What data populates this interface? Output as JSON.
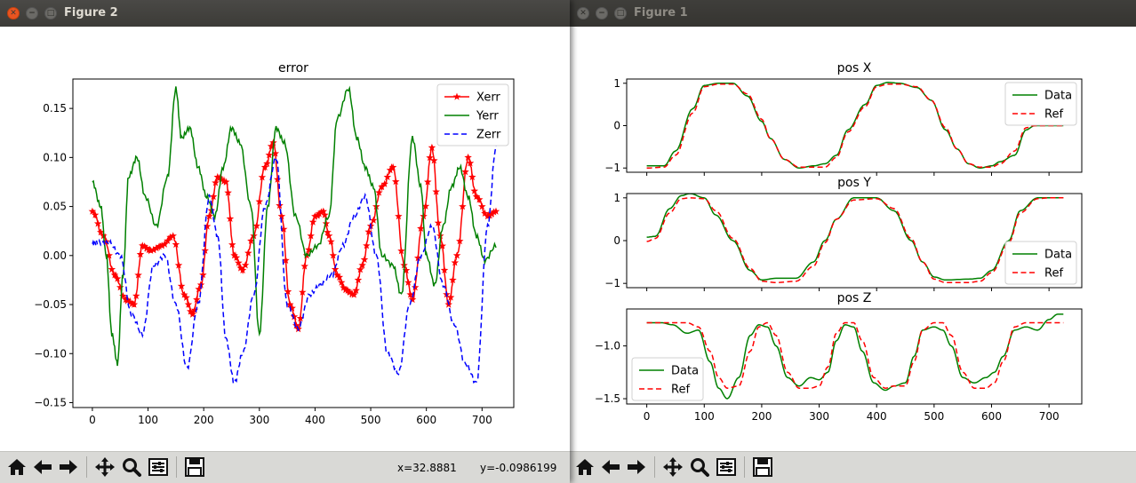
{
  "windows": {
    "figure2": {
      "title": "Figure 2"
    },
    "figure1": {
      "title": "Figure 1"
    }
  },
  "toolbar": {
    "icons": [
      "home-icon",
      "back-arrow-icon",
      "forward-arrow-icon",
      "pan-icon",
      "zoom-icon",
      "configure-subplots-icon",
      "save-icon"
    ],
    "coord_x": "x=32.8881",
    "coord_y": "y=-0.0986199"
  },
  "chart_data": [
    {
      "type": "line",
      "window": "Figure 2",
      "title": "error",
      "xlim": [
        -35,
        757
      ],
      "ylim": [
        -0.155,
        0.18
      ],
      "xticks": [
        0,
        100,
        200,
        300,
        400,
        500,
        600,
        700
      ],
      "yticks": [
        -0.15,
        -0.1,
        -0.05,
        0.0,
        0.05,
        0.1,
        0.15
      ],
      "ytick_labels": [
        "−0.15",
        "−0.10",
        "−0.05",
        "0.00",
        "0.05",
        "0.10",
        "0.15"
      ],
      "legend": "top-right",
      "series": [
        {
          "name": "Xerr",
          "color": "#ff0000",
          "style": "solid-star",
          "x": [
            0,
            20,
            40,
            60,
            75,
            90,
            105,
            125,
            145,
            165,
            180,
            195,
            210,
            225,
            240,
            255,
            270,
            290,
            310,
            325,
            340,
            355,
            370,
            385,
            400,
            415,
            425,
            440,
            455,
            470,
            485,
            500,
            520,
            540,
            560,
            575,
            595,
            610,
            625,
            640,
            655,
            675,
            690,
            710,
            725
          ],
          "y": [
            0.045,
            0.02,
            -0.02,
            -0.045,
            -0.05,
            0.01,
            0.005,
            0.01,
            0.02,
            -0.04,
            -0.06,
            -0.03,
            0.04,
            0.08,
            0.075,
            0.0,
            -0.015,
            0.02,
            0.09,
            0.115,
            0.04,
            -0.05,
            -0.075,
            0.0,
            0.04,
            0.045,
            0.02,
            -0.02,
            -0.035,
            -0.04,
            -0.01,
            0.03,
            0.07,
            0.09,
            -0.01,
            -0.045,
            0.04,
            0.11,
            0.02,
            -0.05,
            0.0,
            0.1,
            0.06,
            0.04,
            0.045
          ]
        },
        {
          "name": "Yerr",
          "color": "#008000",
          "style": "solid",
          "x": [
            0,
            15,
            25,
            35,
            45,
            55,
            65,
            80,
            95,
            115,
            135,
            150,
            160,
            175,
            190,
            205,
            220,
            235,
            250,
            265,
            285,
            300,
            315,
            330,
            345,
            365,
            385,
            405,
            425,
            440,
            460,
            475,
            490,
            505,
            520,
            540,
            555,
            575,
            590,
            600,
            615,
            630,
            645,
            660,
            675,
            690,
            705,
            725
          ],
          "y": [
            0.075,
            0.05,
            0.0,
            -0.08,
            -0.11,
            -0.02,
            0.08,
            0.1,
            0.06,
            0.03,
            0.08,
            0.17,
            0.12,
            0.13,
            0.09,
            0.06,
            0.04,
            0.09,
            0.13,
            0.115,
            0.05,
            -0.08,
            0.05,
            0.13,
            0.115,
            0.04,
            0.0,
            0.01,
            0.04,
            0.14,
            0.17,
            0.12,
            0.09,
            0.07,
            0.0,
            -0.01,
            -0.04,
            0.12,
            0.07,
            0.0,
            -0.03,
            0.03,
            0.07,
            0.09,
            0.06,
            0.02,
            -0.005,
            0.01
          ]
        },
        {
          "name": "Zerr",
          "color": "#0000ff",
          "style": "dashed",
          "x": [
            0,
            10,
            30,
            50,
            70,
            90,
            110,
            130,
            150,
            170,
            190,
            210,
            225,
            240,
            255,
            270,
            290,
            310,
            330,
            350,
            370,
            390,
            410,
            430,
            450,
            470,
            490,
            510,
            530,
            550,
            570,
            590,
            610,
            630,
            650,
            670,
            690,
            710,
            725
          ],
          "y": [
            0.012,
            0.013,
            0.013,
            0.0,
            -0.06,
            -0.08,
            -0.01,
            0.0,
            -0.05,
            -0.115,
            -0.05,
            0.06,
            0.02,
            -0.085,
            -0.13,
            -0.1,
            -0.04,
            0.05,
            0.1,
            -0.05,
            -0.075,
            -0.04,
            -0.03,
            -0.02,
            0.01,
            0.04,
            0.06,
            0.0,
            -0.1,
            -0.12,
            -0.05,
            0.0,
            0.03,
            -0.03,
            -0.07,
            -0.11,
            -0.13,
            0.03,
            0.11
          ]
        }
      ]
    },
    {
      "type": "line",
      "window": "Figure 1",
      "subplots": [
        {
          "title": "pos X",
          "xlim": [
            -35,
            757
          ],
          "ylim": [
            -1.1,
            1.1
          ],
          "yticks": [
            -1,
            0,
            1
          ],
          "ytick_labels": [
            "−1",
            "0",
            "1"
          ],
          "legend": "right",
          "series": [
            {
              "name": "Data",
              "color": "#008000",
              "style": "solid",
              "x": [
                0,
                30,
                50,
                80,
                100,
                125,
                150,
                175,
                200,
                215,
                240,
                265,
                290,
                310,
                330,
                350,
                380,
                400,
                420,
                440,
                470,
                495,
                520,
                540,
                560,
                580,
                600,
                615,
                640,
                660,
                675,
                700,
                725
              ],
              "y": [
                -0.95,
                -0.95,
                -0.6,
                0.4,
                0.95,
                1.0,
                1.0,
                0.7,
                0.1,
                -0.3,
                -0.8,
                -1.0,
                -0.95,
                -0.9,
                -0.7,
                -0.1,
                0.5,
                0.95,
                1.02,
                1.0,
                0.9,
                0.6,
                -0.1,
                -0.55,
                -0.9,
                -1.0,
                -0.95,
                -0.85,
                -0.7,
                -0.1,
                0.0,
                0.0,
                0.0
              ]
            },
            {
              "name": "Ref",
              "color": "#ff0000",
              "style": "dashed",
              "x": [
                0,
                30,
                50,
                80,
                100,
                125,
                150,
                175,
                200,
                215,
                240,
                265,
                290,
                310,
                330,
                350,
                380,
                400,
                420,
                440,
                470,
                495,
                520,
                540,
                560,
                580,
                600,
                615,
                640,
                660,
                675,
                700,
                725
              ],
              "y": [
                -1.0,
                -0.98,
                -0.7,
                0.3,
                0.92,
                0.98,
                0.98,
                0.75,
                0.15,
                -0.3,
                -0.8,
                -0.98,
                -0.98,
                -0.98,
                -0.75,
                -0.15,
                0.45,
                0.92,
                0.98,
                0.98,
                0.92,
                0.6,
                -0.05,
                -0.55,
                -0.9,
                -0.98,
                -0.98,
                -0.9,
                -0.6,
                -0.05,
                0.0,
                0.0,
                0.0
              ]
            }
          ]
        },
        {
          "title": "pos Y",
          "xlim": [
            -35,
            757
          ],
          "ylim": [
            -1.1,
            1.1
          ],
          "yticks": [
            -1,
            0,
            1
          ],
          "ytick_labels": [
            "−1",
            "0",
            "1"
          ],
          "legend": "lower-right",
          "series": [
            {
              "name": "Data",
              "color": "#008000",
              "style": "solid",
              "x": [
                0,
                15,
                40,
                60,
                75,
                100,
                120,
                150,
                180,
                200,
                225,
                260,
                290,
                310,
                330,
                360,
                400,
                430,
                460,
                480,
                500,
                520,
                560,
                580,
                600,
                630,
                650,
                680,
                700,
                725
              ],
              "y": [
                0.08,
                0.1,
                0.75,
                1.05,
                1.1,
                1.0,
                0.6,
                0.0,
                -0.7,
                -0.92,
                -0.88,
                -0.88,
                -0.5,
                0.0,
                0.5,
                1.0,
                1.0,
                0.7,
                0.0,
                -0.5,
                -0.85,
                -0.92,
                -0.9,
                -0.88,
                -0.7,
                0.0,
                0.7,
                1.0,
                1.0,
                1.0
              ]
            },
            {
              "name": "Ref",
              "color": "#ff0000",
              "style": "dashed",
              "x": [
                0,
                15,
                40,
                60,
                75,
                100,
                120,
                150,
                180,
                200,
                225,
                260,
                290,
                310,
                330,
                360,
                400,
                430,
                460,
                480,
                500,
                520,
                560,
                580,
                600,
                630,
                650,
                680,
                700,
                725
              ],
              "y": [
                -0.02,
                0.05,
                0.65,
                0.98,
                1.0,
                0.98,
                0.7,
                0.05,
                -0.65,
                -0.95,
                -0.98,
                -0.95,
                -0.6,
                -0.05,
                0.5,
                0.95,
                0.98,
                0.75,
                0.05,
                -0.5,
                -0.9,
                -0.98,
                -0.98,
                -0.95,
                -0.75,
                -0.05,
                0.65,
                0.98,
                1.0,
                1.0
              ]
            }
          ]
        },
        {
          "title": "pos Z",
          "xlim": [
            -35,
            757
          ],
          "ylim": [
            -1.55,
            -0.65
          ],
          "yticks": [
            -1.5,
            -1.0
          ],
          "ytick_labels": [
            "−1.5",
            "−1.0"
          ],
          "legend": "lower-left",
          "series": [
            {
              "name": "Data",
              "color": "#008000",
              "style": "solid",
              "x": [
                0,
                25,
                45,
                70,
                90,
                110,
                125,
                140,
                160,
                180,
                195,
                210,
                225,
                245,
                265,
                285,
                300,
                315,
                330,
                345,
                360,
                375,
                395,
                415,
                430,
                450,
                465,
                480,
                500,
                515,
                530,
                550,
                570,
                590,
                605,
                620,
                640,
                660,
                680,
                700,
                715,
                725
              ],
              "y": [
                -0.78,
                -0.78,
                -0.8,
                -0.88,
                -0.85,
                -1.15,
                -1.4,
                -1.5,
                -1.3,
                -0.9,
                -0.8,
                -0.82,
                -1.0,
                -1.3,
                -1.38,
                -1.3,
                -1.32,
                -1.25,
                -0.95,
                -0.8,
                -0.82,
                -1.05,
                -1.35,
                -1.42,
                -1.38,
                -1.35,
                -1.1,
                -0.85,
                -0.82,
                -0.85,
                -1.0,
                -1.3,
                -1.35,
                -1.3,
                -1.25,
                -1.1,
                -0.85,
                -0.82,
                -0.85,
                -0.75,
                -0.7,
                -0.7
              ]
            },
            {
              "name": "Ref",
              "color": "#ff0000",
              "style": "dashed",
              "x": [
                0,
                25,
                45,
                70,
                90,
                110,
                125,
                140,
                160,
                180,
                195,
                210,
                225,
                245,
                265,
                285,
                300,
                315,
                330,
                345,
                360,
                375,
                395,
                415,
                430,
                450,
                465,
                480,
                500,
                515,
                530,
                550,
                570,
                590,
                605,
                620,
                640,
                660,
                680,
                700,
                715,
                725
              ],
              "y": [
                -0.78,
                -0.78,
                -0.78,
                -0.78,
                -0.82,
                -1.05,
                -1.3,
                -1.4,
                -1.38,
                -1.05,
                -0.82,
                -0.78,
                -0.9,
                -1.25,
                -1.4,
                -1.4,
                -1.38,
                -1.2,
                -0.88,
                -0.78,
                -0.78,
                -0.95,
                -1.3,
                -1.4,
                -1.38,
                -1.38,
                -1.15,
                -0.85,
                -0.78,
                -0.78,
                -0.9,
                -1.25,
                -1.4,
                -1.4,
                -1.35,
                -1.15,
                -0.82,
                -0.78,
                -0.78,
                -0.78,
                -0.78,
                -0.78
              ]
            }
          ]
        }
      ],
      "xticks": [
        0,
        100,
        200,
        300,
        400,
        500,
        600,
        700
      ]
    }
  ]
}
